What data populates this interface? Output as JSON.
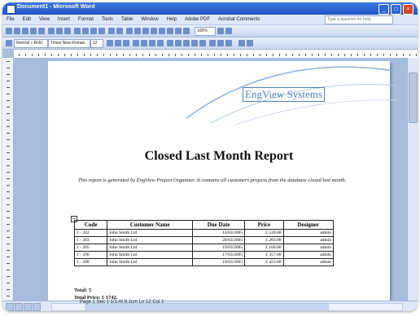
{
  "window": {
    "title": "Document1 - Microsoft Word",
    "buttons": [
      "_",
      "□",
      "×"
    ]
  },
  "menubar": {
    "items": [
      "File",
      "Edit",
      "View",
      "Insert",
      "Format",
      "Tools",
      "Table",
      "Window",
      "Help",
      "Adobe PDF",
      "Acrobat Comments"
    ],
    "ask_placeholder": "Type a question for help"
  },
  "toolbar": {
    "style_value": "Normal + Bold",
    "font_value": "Times New Roman",
    "size_value": "12",
    "zoom_value": "100%"
  },
  "logo": {
    "text": "EngView Systems"
  },
  "report": {
    "title": "Closed Last Month Report",
    "description": "This report is generated by EngView Project Organizer. It contains all customers projects from the database closed last month.",
    "table": {
      "headers": [
        "Code",
        "Customer Name",
        "Due Date",
        "Price",
        "Designer"
      ],
      "rows": [
        [
          "1 - 202",
          "John Smith Ltd",
          "14/03/2005",
          "£ 520.00",
          "admin"
        ],
        [
          "1 - 203",
          "John Smith Ltd",
          "20/03/2005",
          "£ 283.00",
          "admin"
        ],
        [
          "1 - 205",
          "John Smith Ltd",
          "19/03/2005",
          "£ 160.00",
          "admin"
        ],
        [
          "1 - 206",
          "John Smith Ltd",
          "17/03/2005",
          "£ 357.00",
          "admin"
        ],
        [
          "1 - 208",
          "John Smith Ltd",
          "19/03/2005",
          "£ 423.00",
          "admin"
        ]
      ]
    },
    "total_count": "Total: 5",
    "total_price": "Total Price: £ 1742."
  },
  "statusbar": {
    "text": "Page 1   Sec 1   1/1   At 8.1cm   Ln 12   Col 1"
  }
}
